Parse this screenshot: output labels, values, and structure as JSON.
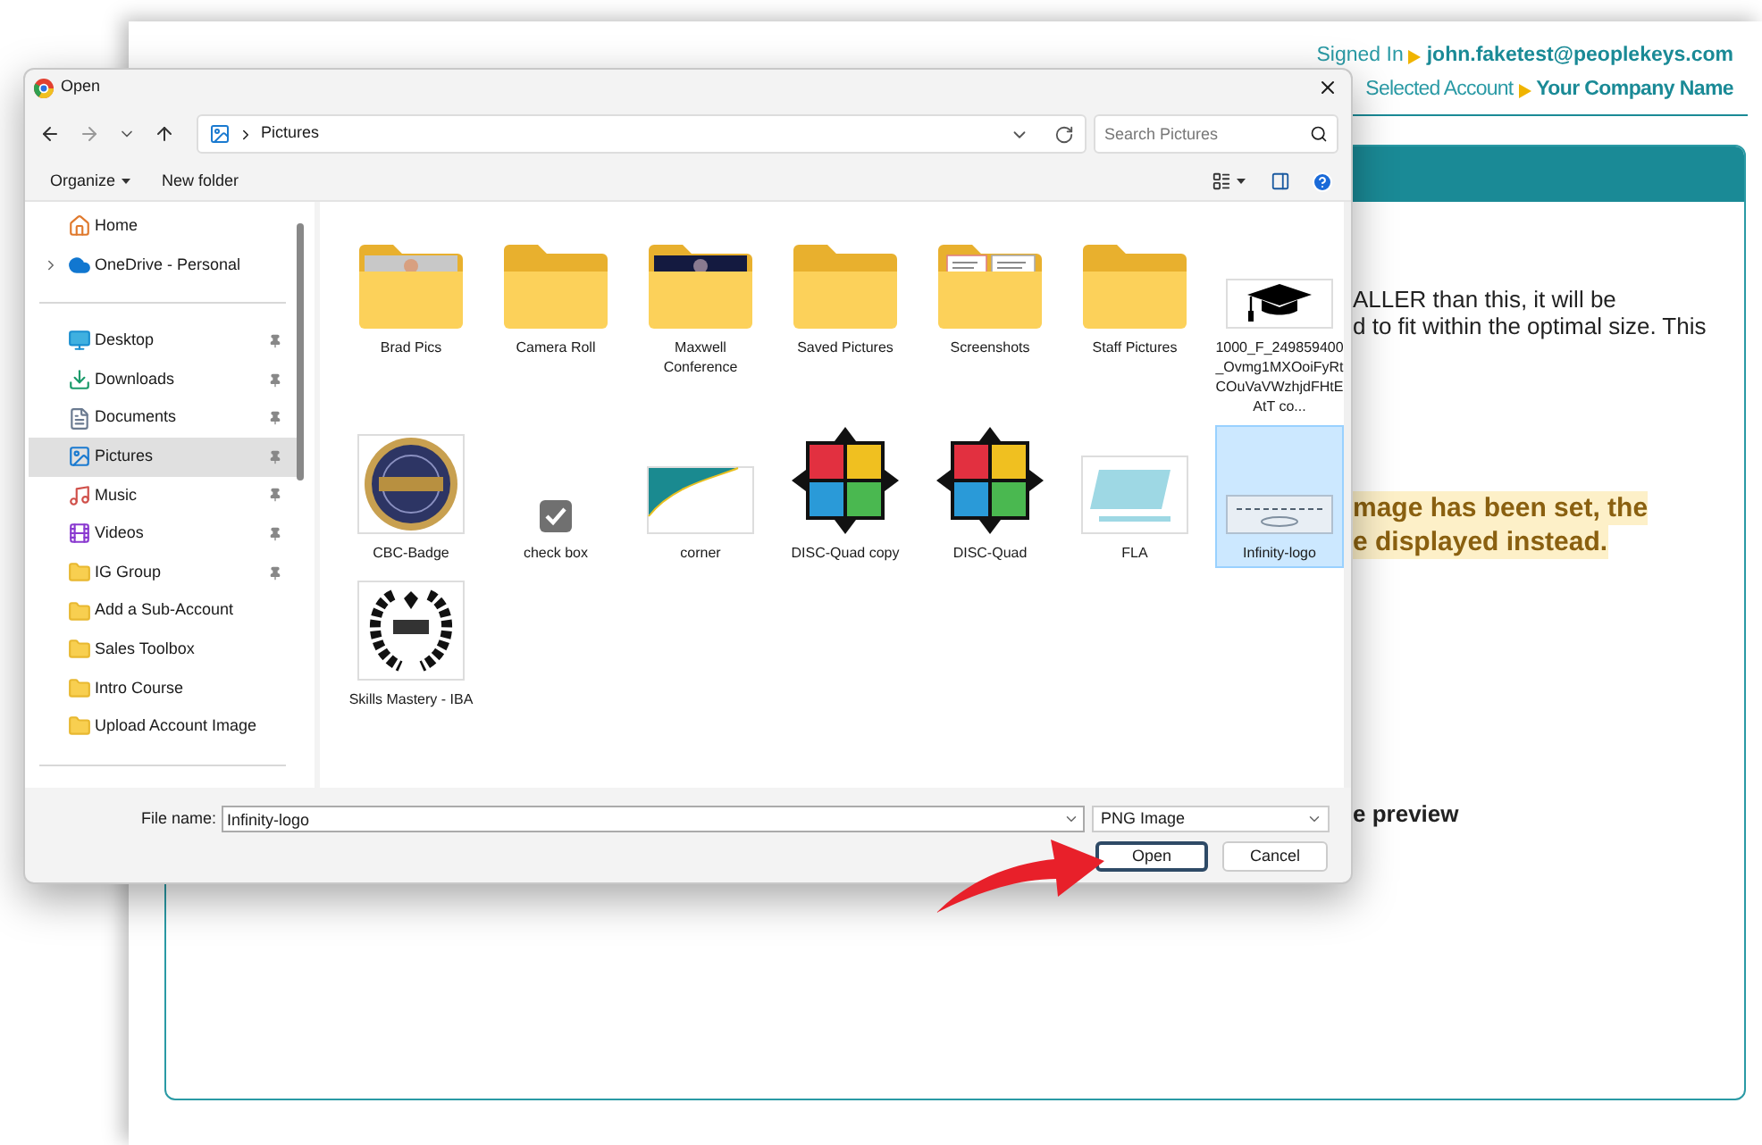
{
  "page": {
    "signed_in": {
      "label": "Signed In",
      "value": "john.faketest@peoplekeys.com"
    },
    "selected_account": {
      "label": "Selected Account",
      "value": "Your Company Name"
    },
    "panel": {
      "text_lines": [
        "ALLER than this, it will be",
        "d to fit within the optimal size. This"
      ],
      "notice_lines": [
        "mage has been set, the",
        "e displayed instead."
      ],
      "preview_heading": "e preview"
    }
  },
  "dialog": {
    "title": "Open",
    "path": "Pictures",
    "search": {
      "placeholder": "Search Pictures"
    },
    "commands": [
      {
        "label": "Organize",
        "menu": true
      },
      {
        "label": "New folder",
        "menu": false
      }
    ],
    "sidebar": {
      "sections": [
        {
          "items": [
            {
              "label": "Home",
              "kind": "home",
              "pinned": false,
              "selected": false,
              "expandable": false
            },
            {
              "label": "OneDrive - Personal",
              "kind": "cloud",
              "pinned": false,
              "selected": false,
              "expandable": true
            }
          ]
        },
        {
          "items": [
            {
              "label": "Desktop",
              "kind": "desktop",
              "pinned": true,
              "selected": false,
              "expandable": false
            },
            {
              "label": "Downloads",
              "kind": "download",
              "pinned": true,
              "selected": false,
              "expandable": false
            },
            {
              "label": "Documents",
              "kind": "document",
              "pinned": true,
              "selected": false,
              "expandable": false
            },
            {
              "label": "Pictures",
              "kind": "pictures",
              "pinned": true,
              "selected": true,
              "expandable": false
            },
            {
              "label": "Music",
              "kind": "music",
              "pinned": true,
              "selected": false,
              "expandable": false
            },
            {
              "label": "Videos",
              "kind": "videos",
              "pinned": true,
              "selected": false,
              "expandable": false
            },
            {
              "label": "IG Group",
              "kind": "folder",
              "pinned": true,
              "selected": false,
              "expandable": false
            },
            {
              "label": "Add a Sub-Account",
              "kind": "folder",
              "pinned": false,
              "selected": false,
              "expandable": false
            },
            {
              "label": "Sales Toolbox",
              "kind": "folder",
              "pinned": false,
              "selected": false,
              "expandable": false
            },
            {
              "label": "Intro Course",
              "kind": "folder",
              "pinned": false,
              "selected": false,
              "expandable": false
            },
            {
              "label": "Upload Account Image",
              "kind": "folder",
              "pinned": false,
              "selected": false,
              "expandable": false
            }
          ]
        }
      ]
    },
    "files": [
      {
        "name": "Brad Pics",
        "kind": "photofolder",
        "selected": false
      },
      {
        "name": "Camera Roll",
        "kind": "folder",
        "selected": false
      },
      {
        "name": "Maxwell Conference",
        "kind": "photofolder",
        "selected": false
      },
      {
        "name": "Saved Pictures",
        "kind": "folder",
        "selected": false
      },
      {
        "name": "Screenshots",
        "kind": "docfolder",
        "selected": false
      },
      {
        "name": "Staff Pictures",
        "kind": "folder",
        "selected": false
      },
      {
        "name": "1000_F_249859400_Ovmg1MXOoiFyRtCOuVaVWzhjdFHtEAtT co...",
        "kind": "cap",
        "selected": false
      },
      {
        "name": "CBC-Badge",
        "kind": "seal",
        "selected": false
      },
      {
        "name": "check box",
        "kind": "checkbox",
        "selected": false
      },
      {
        "name": "corner",
        "kind": "card",
        "selected": false
      },
      {
        "name": "DISC-Quad copy",
        "kind": "quad",
        "selected": false
      },
      {
        "name": "DISC-Quad",
        "kind": "quad",
        "selected": false
      },
      {
        "name": "FLA",
        "kind": "emblem",
        "selected": false
      },
      {
        "name": "Infinity-logo",
        "kind": "banner",
        "selected": true
      },
      {
        "name": "Skills Mastery - IBA",
        "kind": "wreath",
        "selected": false
      }
    ],
    "file_name": {
      "label": "File name:",
      "value": "Infinity-logo"
    },
    "file_type": "PNG Image",
    "buttons": [
      {
        "label": "Open",
        "default": true
      },
      {
        "label": "Cancel",
        "default": false
      }
    ]
  }
}
